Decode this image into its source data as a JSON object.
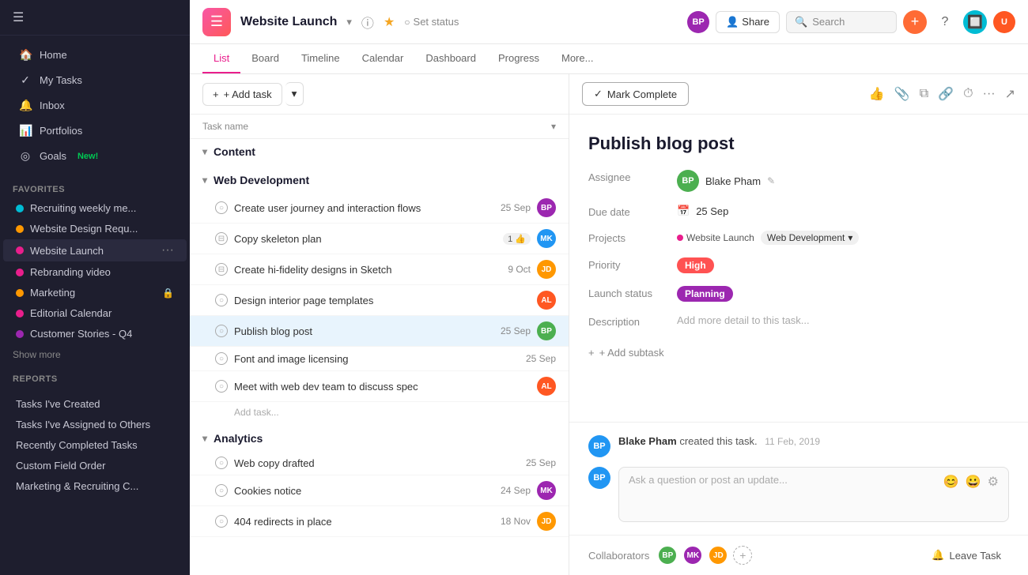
{
  "sidebar": {
    "nav": [
      {
        "id": "home",
        "label": "Home",
        "icon": "🏠"
      },
      {
        "id": "my-tasks",
        "label": "My Tasks",
        "icon": "✓"
      },
      {
        "id": "inbox",
        "label": "Inbox",
        "icon": "🔔"
      },
      {
        "id": "portfolios",
        "label": "Portfolios",
        "icon": "▪▪"
      },
      {
        "id": "goals",
        "label": "Goals",
        "icon": "◎",
        "badge": "New!"
      }
    ],
    "favorites_title": "Favorites",
    "favorites": [
      {
        "id": "recruiting",
        "label": "Recruiting weekly me...",
        "color": "#00bcd4"
      },
      {
        "id": "website-design",
        "label": "Website Design Requ...",
        "color": "#ff9800"
      },
      {
        "id": "website-launch",
        "label": "Website Launch",
        "color": "#e91e8c",
        "active": true
      },
      {
        "id": "rebranding",
        "label": "Rebranding video",
        "color": "#e91e8c"
      },
      {
        "id": "marketing",
        "label": "Marketing",
        "color": "#ff9800",
        "locked": true
      }
    ],
    "more_items": [
      {
        "id": "editorial",
        "label": "Editorial Calendar",
        "color": "#e91e8c"
      },
      {
        "id": "customer",
        "label": "Customer Stories - Q4",
        "color": "#9c27b0"
      }
    ],
    "show_more": "Show more",
    "reports_title": "Reports",
    "reports": [
      {
        "id": "tasks-created",
        "label": "Tasks I've Created"
      },
      {
        "id": "tasks-assigned",
        "label": "Tasks I've Assigned to Others"
      },
      {
        "id": "recently-completed",
        "label": "Recently Completed Tasks"
      },
      {
        "id": "custom-field",
        "label": "Custom Field Order"
      },
      {
        "id": "marketing-recruiting",
        "label": "Marketing & Recruiting C..."
      }
    ]
  },
  "topbar": {
    "project_name": "Website Launch",
    "set_status": "Set status",
    "share_label": "Share",
    "search_placeholder": "Search",
    "tabs": [
      {
        "id": "list",
        "label": "List",
        "active": true
      },
      {
        "id": "board",
        "label": "Board"
      },
      {
        "id": "timeline",
        "label": "Timeline"
      },
      {
        "id": "calendar",
        "label": "Calendar"
      },
      {
        "id": "dashboard",
        "label": "Dashboard"
      },
      {
        "id": "progress",
        "label": "Progress"
      },
      {
        "id": "more",
        "label": "More..."
      }
    ]
  },
  "task_list": {
    "add_task_label": "+ Add task",
    "col_header": "Task name",
    "sections": [
      {
        "id": "content",
        "name": "Content",
        "tasks": []
      },
      {
        "id": "web-development",
        "name": "Web Development",
        "tasks": [
          {
            "id": "t1",
            "name": "Create user journey and interaction flows",
            "date": "25 Sep",
            "assignee_color": "#9c27b0",
            "assignee_initials": "BP"
          },
          {
            "id": "t2",
            "name": "Copy skeleton plan",
            "date": "",
            "assignee_color": "#2196f3",
            "assignee_initials": "MK",
            "badge": "1 👍"
          },
          {
            "id": "t3",
            "name": "Create hi-fidelity designs in Sketch",
            "date": "9 Oct",
            "assignee_color": "#ff9800",
            "assignee_initials": "JD"
          },
          {
            "id": "t4",
            "name": "Design interior page templates",
            "date": "",
            "assignee_color": "#ff5722",
            "assignee_initials": "AL"
          },
          {
            "id": "t5",
            "name": "Publish blog post",
            "date": "25 Sep",
            "assignee_color": "#4caf50",
            "assignee_initials": "BP",
            "selected": true
          },
          {
            "id": "t6",
            "name": "Font and image licensing",
            "date": "25 Sep",
            "assignee_color": null,
            "assignee_initials": ""
          },
          {
            "id": "t7",
            "name": "Meet with web dev team to discuss spec",
            "date": "",
            "assignee_color": "#ff5722",
            "assignee_initials": "AL"
          }
        ],
        "add_task_placeholder": "Add task..."
      },
      {
        "id": "analytics",
        "name": "Analytics",
        "tasks": [
          {
            "id": "a1",
            "name": "Web copy drafted",
            "date": "25 Sep",
            "assignee_color": null,
            "assignee_initials": ""
          },
          {
            "id": "a2",
            "name": "Cookies notice",
            "date": "24 Sep",
            "assignee_color": "#9c27b0",
            "assignee_initials": "MK"
          },
          {
            "id": "a3",
            "name": "404 redirects in place",
            "date": "18 Nov",
            "assignee_color": "#ff9800",
            "assignee_initials": "JD"
          }
        ]
      }
    ]
  },
  "task_detail": {
    "mark_complete_label": "Mark Complete",
    "title": "Publish blog post",
    "assignee_label": "Assignee",
    "assignee_name": "Blake Pham",
    "due_date_label": "Due date",
    "due_date": "25 Sep",
    "projects_label": "Projects",
    "project1": "Website Launch",
    "project2": "Web Development",
    "priority_label": "Priority",
    "priority": "High",
    "launch_status_label": "Launch status",
    "launch_status": "Planning",
    "description_label": "Description",
    "description_placeholder": "Add more detail to this task...",
    "add_subtask_label": "+ Add subtask",
    "activity": {
      "user_name": "Blake Pham",
      "action": "created this task.",
      "time": "11 Feb, 2019",
      "comment_placeholder": "Ask a question or post an update..."
    },
    "collaborators_label": "Collaborators",
    "leave_task_label": "Leave Task"
  }
}
